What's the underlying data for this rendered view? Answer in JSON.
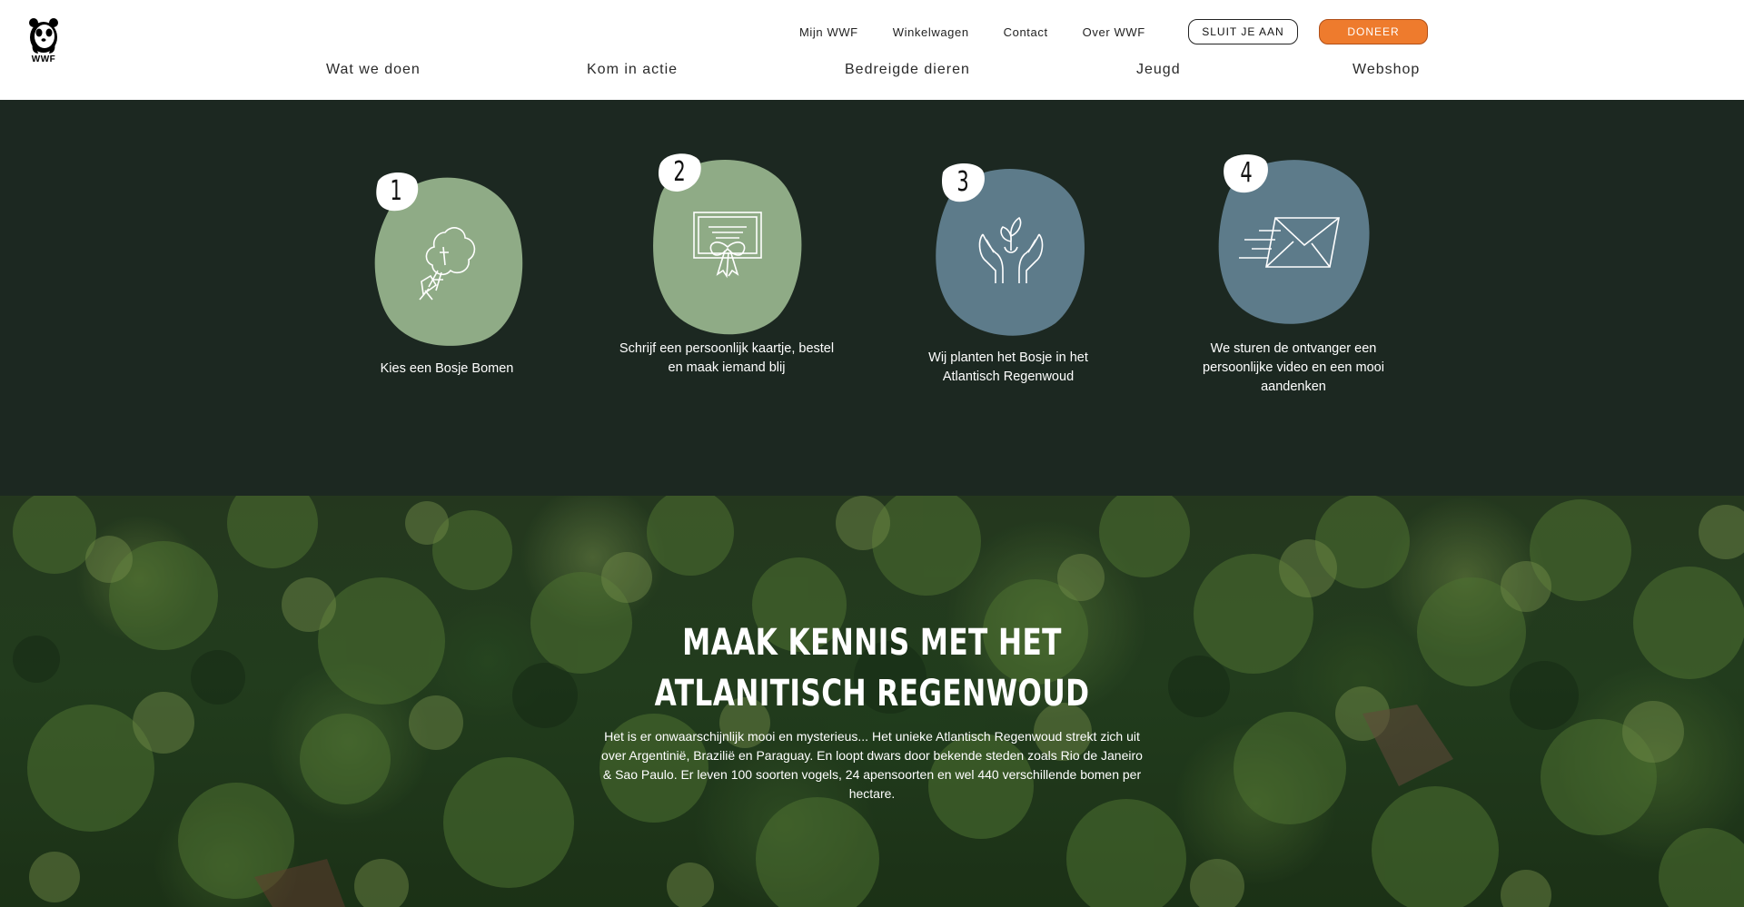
{
  "header": {
    "logo_text": "WWF",
    "utility_nav": [
      "Mijn WWF",
      "Winkelwagen",
      "Contact",
      "Over WWF"
    ],
    "join_button": "SLUIT JE AAN",
    "donate_button": "DONEER",
    "main_nav": [
      "Wat we doen",
      "Kom in actie",
      "Bedreigde dieren",
      "Jeugd",
      "Webshop"
    ]
  },
  "colors": {
    "steps_background": "#1c2821",
    "blob_green": "#8fab86",
    "blob_blue": "#5d7b8a",
    "donate_orange": "#ee7b2d"
  },
  "steps": [
    {
      "number": "1",
      "caption": "Kies een Bosje Bomen",
      "icon": "tree-bouquet-icon"
    },
    {
      "number": "2",
      "caption": "Schrijf een persoonlijk kaartje, bestel en maak iemand blij",
      "icon": "gift-card-icon"
    },
    {
      "number": "3",
      "caption": "Wij planten het Bosje in het Atlantisch Regenwoud",
      "icon": "hands-sprout-icon"
    },
    {
      "number": "4",
      "caption": "We sturen de ontvanger een persoonlijke video en een mooi aandenken",
      "icon": "sending-envelope-icon"
    }
  ],
  "forest": {
    "title": "MAAK KENNIS MET HET ATLANITISCH REGENWOUD",
    "body": "Het is er onwaarschijnlijk mooi en mysterieus... Het unieke Atlantisch Regenwoud strekt zich uit over Argentinië, Brazilië en Paraguay. En loopt dwars door bekende steden zoals Rio de Janeiro & Sao Paulo. Er leven 100 soorten vogels, 24 apensoorten en wel 440 verschillende bomen per hectare."
  }
}
